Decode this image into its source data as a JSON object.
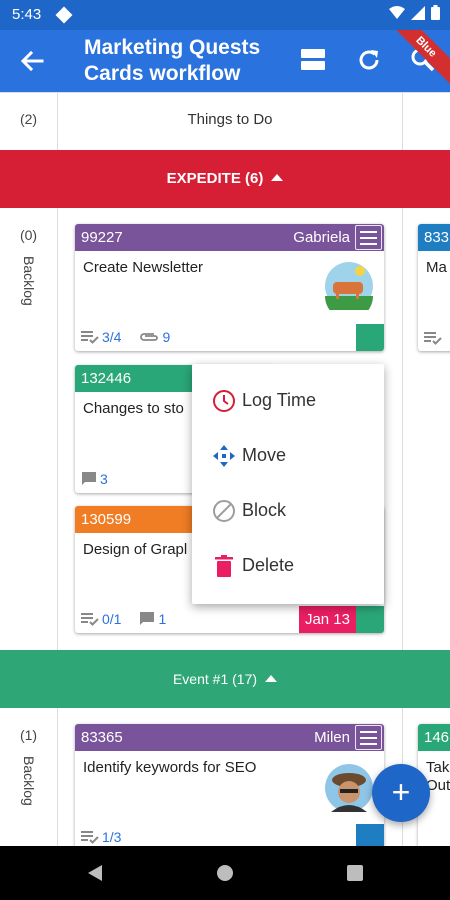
{
  "status_bar": {
    "time": "5:43"
  },
  "app_bar": {
    "title_line1": "Marketing Quests",
    "title_line2": "Cards workflow",
    "ribbon_text": "Blue"
  },
  "board": {
    "top_column": {
      "count": "(2)",
      "title": "Things to Do"
    },
    "lanes": [
      {
        "name": "EXPEDITE (6)",
        "color": "#d61f35",
        "column_count": "(0)",
        "column_label": "Backlog",
        "cards": [
          {
            "id": "99227",
            "owner": "Gabriela",
            "header_color": "#7a549b",
            "title": "Create Newsletter",
            "checklist": "3/4",
            "attachments": "9",
            "strip_color": "#2aa778"
          },
          {
            "id": "132446",
            "header_color": "#2aa778",
            "title": "Changes to sto",
            "comments": "3"
          },
          {
            "id": "130599",
            "header_color": "#f07c24",
            "title": "Design of Grapl",
            "checklist": "0/1",
            "comments": "1",
            "due_date": "Jan 13",
            "date_color": "#e91e63",
            "strip_color": "#2aa778"
          }
        ],
        "right_card": {
          "id": "833",
          "title": "Ma",
          "header_color": "#1f7dc2"
        }
      },
      {
        "name": "Event #1 (17)",
        "color": "#2ea675",
        "column_count": "(1)",
        "column_label": "Backlog",
        "cards": [
          {
            "id": "83365",
            "owner": "Milen",
            "header_color": "#7a549b",
            "title": "Identify keywords for SEO",
            "checklist": "1/3",
            "strip_color": "#1f7dc2"
          }
        ],
        "right_card": {
          "id": "146",
          "title_line1": "Tak",
          "title_line2": "Out",
          "header_color": "#2aa778"
        }
      }
    ]
  },
  "context_menu": {
    "items": [
      {
        "label": "Log Time",
        "icon": "clock-icon",
        "color": "#d61f35"
      },
      {
        "label": "Move",
        "icon": "move-arrows-icon",
        "color": "#1f66c9"
      },
      {
        "label": "Block",
        "icon": "block-icon",
        "color": "#9e9e9e"
      },
      {
        "label": "Delete",
        "icon": "trash-icon",
        "color": "#e91e63"
      }
    ]
  },
  "fab": {
    "label": "+"
  }
}
